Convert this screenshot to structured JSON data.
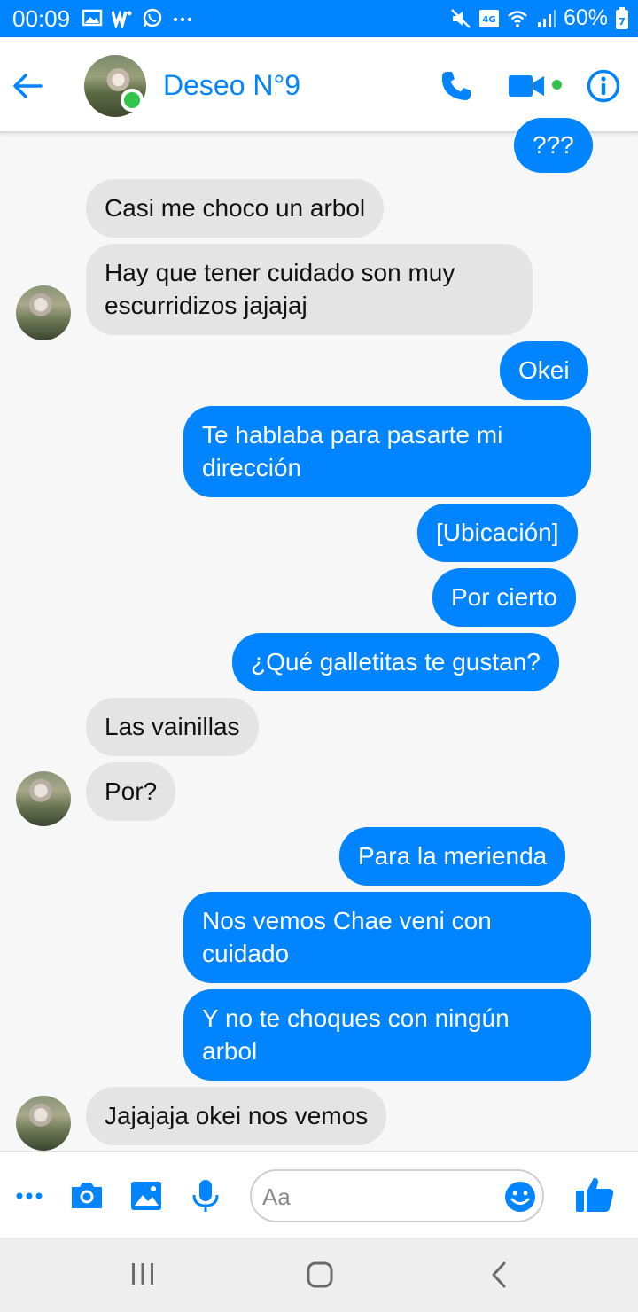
{
  "status_bar": {
    "time": "00:09",
    "battery_percent": "60%",
    "battery_level_text": "7",
    "network_label": "4G"
  },
  "header": {
    "contact_name": "Deseo N°9",
    "online": true,
    "accent_color": "#0084ff",
    "online_color": "#31c44a"
  },
  "messages": [
    {
      "dir": "out",
      "text": "???"
    },
    {
      "dir": "in",
      "text": "Casi me choco un arbol"
    },
    {
      "dir": "in",
      "lines": [
        "Hay que tener cuidado son muy",
        "escurridizos jajajaj"
      ]
    },
    {
      "dir": "out",
      "text": "Okei"
    },
    {
      "dir": "out",
      "lines": [
        "Te hablaba para pasarte mi",
        "dirección"
      ]
    },
    {
      "dir": "out",
      "text": "[Ubicación]"
    },
    {
      "dir": "out",
      "text": "Por cierto"
    },
    {
      "dir": "out",
      "text": "¿Qué galletitas te gustan?"
    },
    {
      "dir": "in",
      "text": "Las vainillas"
    },
    {
      "dir": "in",
      "text": "Por?"
    },
    {
      "dir": "out",
      "text": "Para la merienda"
    },
    {
      "dir": "out",
      "lines": [
        "Nos vemos Chae veni con",
        "cuidado"
      ]
    },
    {
      "dir": "out",
      "lines": [
        "Y no te choques con ningún",
        "arbol"
      ]
    },
    {
      "dir": "in",
      "text": "Jajajaja okei nos vemos"
    }
  ],
  "composer": {
    "placeholder": "Aa",
    "icons": [
      "more-icon",
      "camera-icon",
      "gallery-icon",
      "microphone-icon",
      "emoji-icon",
      "like-icon"
    ]
  },
  "nav_bar": {
    "icons": [
      "recent-apps-icon",
      "home-icon",
      "back-nav-icon"
    ]
  }
}
